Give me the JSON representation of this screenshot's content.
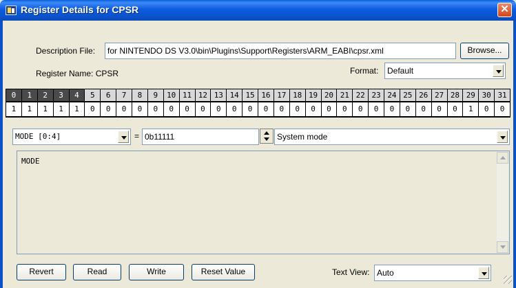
{
  "window": {
    "title": "Register Details for CPSR",
    "close_glyph": "✕"
  },
  "description": {
    "label": "Description File:",
    "value": "for NINTENDO DS V3.0\\bin\\Plugins\\Support\\Registers\\ARM_EABI\\cpsr.xml",
    "browse_label": "Browse..."
  },
  "register": {
    "name_label": "Register Name: CPSR"
  },
  "format": {
    "label": "Format:",
    "selected": "Default"
  },
  "bits": {
    "indices": [
      "0",
      "1",
      "2",
      "3",
      "4",
      "5",
      "6",
      "7",
      "8",
      "9",
      "10",
      "11",
      "12",
      "13",
      "14",
      "15",
      "16",
      "17",
      "18",
      "19",
      "20",
      "21",
      "22",
      "23",
      "24",
      "25",
      "26",
      "27",
      "28",
      "29",
      "30",
      "31"
    ],
    "values": [
      "1",
      "1",
      "1",
      "1",
      "1",
      "0",
      "0",
      "0",
      "0",
      "0",
      "0",
      "0",
      "0",
      "0",
      "0",
      "0",
      "0",
      "0",
      "0",
      "0",
      "0",
      "0",
      "0",
      "0",
      "0",
      "0",
      "0",
      "0",
      "0",
      "1",
      "0",
      "0"
    ],
    "highlighted_count": 5
  },
  "field": {
    "name": "MODE [0:4]",
    "equals": "=",
    "value": "0b11111",
    "meaning": "System mode"
  },
  "description_text": "MODE",
  "buttons": {
    "revert": "Revert",
    "read": "Read",
    "write": "Write",
    "reset": "Reset Value"
  },
  "text_view": {
    "label": "Text View:",
    "selected": "Auto"
  },
  "icons": {
    "window_icon": "register-app-icon",
    "close": "close-icon",
    "spinner": "spinner-icon",
    "grip": "resize-grip-icon"
  },
  "colors": {
    "titlebar": "#0b51c8",
    "bit_highlight": "#4a4a4a",
    "bit_header": "#d8d8d8"
  }
}
